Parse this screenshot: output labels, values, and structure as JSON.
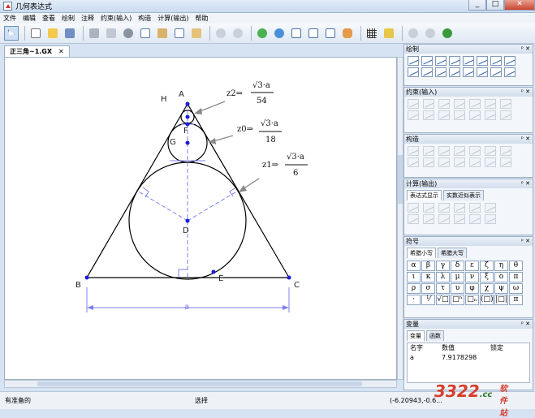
{
  "window": {
    "title": "几何表达式",
    "min": "_",
    "max": "□",
    "close": "✕"
  },
  "menu": [
    "文件",
    "编辑",
    "查看",
    "绘制",
    "注释",
    "约束(输入)",
    "构造",
    "计算(输出)",
    "帮助"
  ],
  "doc_tab": {
    "label": "正三角~1.GX",
    "close": "✕"
  },
  "canvas": {
    "labels": {
      "H": "H",
      "A": "A",
      "F": "F",
      "G": "G",
      "D": "D",
      "E": "E",
      "B": "B",
      "C": "C",
      "a": "a"
    },
    "exprs": [
      {
        "name": "z2⇒",
        "num": "√3·a",
        "den": "54"
      },
      {
        "name": "z0⇒",
        "num": "√3·a",
        "den": "18"
      },
      {
        "name": "z1⇒",
        "num": "√3·a",
        "den": "6"
      }
    ]
  },
  "panels": {
    "draw": {
      "title": "绘制"
    },
    "constraint": {
      "title": "约束(输入)"
    },
    "construct": {
      "title": "构造"
    },
    "compute": {
      "title": "计算(输出)",
      "tabs": [
        "表达式显示",
        "实数近似表示"
      ]
    },
    "symbols": {
      "title": "符号",
      "tabs": [
        "希腊小写",
        "希腊大写"
      ],
      "items": [
        "α",
        "β",
        "γ",
        "δ",
        "ε",
        "ζ",
        "η",
        "θ",
        "ι",
        "κ",
        "λ",
        "μ",
        "ν",
        "ξ",
        "ο",
        "π",
        "ρ",
        "σ",
        "τ",
        "υ",
        "φ",
        "χ",
        "ψ",
        "ω",
        "·",
        "⅟",
        "√□",
        "□ⁿ",
        "□ₙ",
        "(□)",
        "|□|",
        "π"
      ]
    },
    "variables": {
      "title": "变量",
      "tabs": [
        "变量",
        "函数"
      ],
      "headers": [
        "名字",
        "数值",
        "锁定"
      ],
      "rows": [
        {
          "name": "a",
          "value": "7.9178298",
          "locked": ""
        }
      ]
    }
  },
  "status": {
    "left": "有准备的",
    "mid": "选择",
    "right": "(-6.20943,-0.6..."
  },
  "watermark": {
    "main": "3322",
    "sub": ".cc",
    "tag": "软件站"
  },
  "colors": {
    "accent": "#2a5fa5",
    "shape": "#1a1ae0",
    "construction": "#7f7ff0"
  }
}
